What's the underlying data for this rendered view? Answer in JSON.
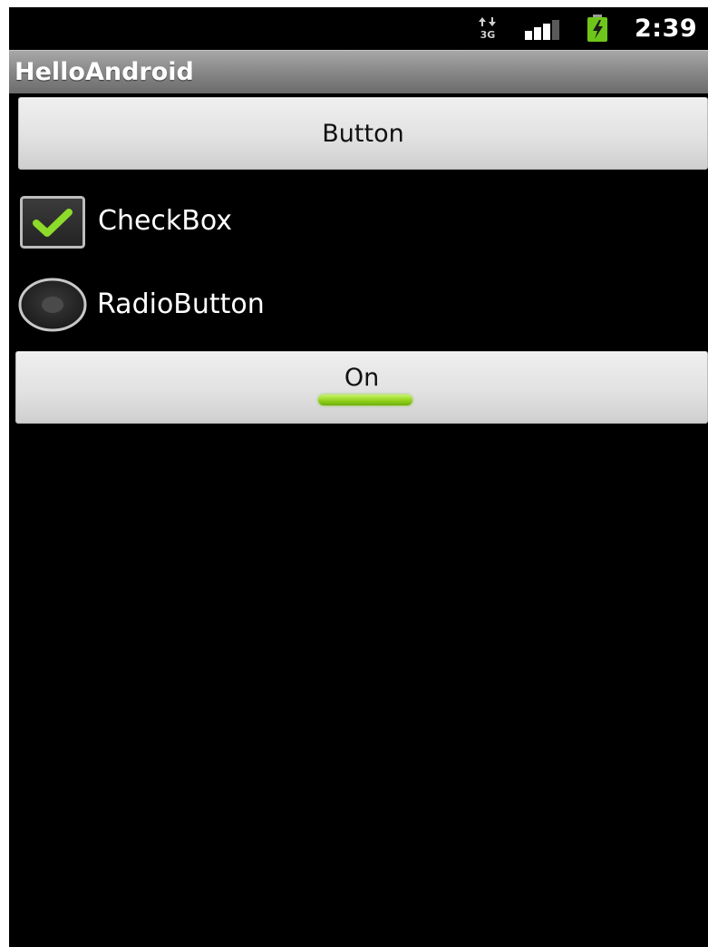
{
  "status_bar": {
    "network_icon": "3g-data-icon",
    "signal_icon": "signal-strength-icon",
    "battery_icon": "battery-charging-icon",
    "time": "2:39"
  },
  "app": {
    "title": "HelloAndroid"
  },
  "widgets": {
    "button_label": "Button",
    "checkbox_label": "CheckBox",
    "checkbox_checked": true,
    "radio_label": "RadioButton",
    "radio_selected": false,
    "toggle_label": "On",
    "toggle_on": true
  },
  "colors": {
    "background": "#000000",
    "accent_green": "#92d21c",
    "button_face": "#e2e2e2"
  }
}
